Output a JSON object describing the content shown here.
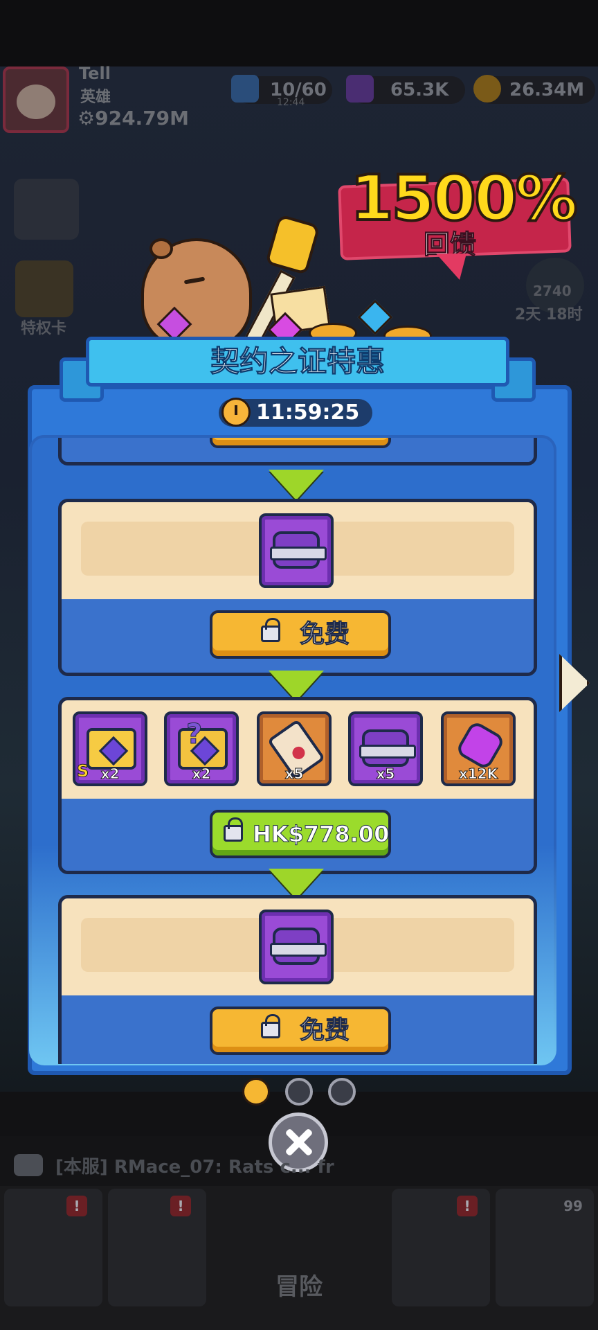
{
  "hud": {
    "player_name": "Tell",
    "player_title": "英雄",
    "power": "924.79M",
    "energy": "10/60",
    "energy_timer": "12:44",
    "gems": "65.3K",
    "gold": "26.34M"
  },
  "side_labels": {
    "privilege_card": "特权卡",
    "event_timer_value": "2740",
    "event_timer_days": "2天 18时"
  },
  "promo": {
    "percent": "1500%",
    "caption": "回馈"
  },
  "panel": {
    "title": "契约之证特惠",
    "countdown": "11:59:25"
  },
  "tiers": [
    {
      "button_label": "免费"
    },
    {
      "button_label": "免费",
      "items": [
        {
          "icon": "purple-chest-icon",
          "qty": ""
        }
      ]
    },
    {
      "button_label": "HK$778.00",
      "items": [
        {
          "icon": "gold-chest-icon",
          "qty": "x2",
          "badge": "S"
        },
        {
          "icon": "mystery-chest-icon",
          "qty": "x2"
        },
        {
          "icon": "scroll-icon",
          "qty": "x5"
        },
        {
          "icon": "purple-chest-icon",
          "qty": "x5"
        },
        {
          "icon": "gem-icon",
          "qty": "x12K"
        }
      ]
    },
    {
      "button_label": "免费",
      "items": [
        {
          "icon": "purple-chest-icon",
          "qty": ""
        }
      ]
    }
  ],
  "pagination": {
    "pages": 3,
    "active_index": 0
  },
  "chat": {
    "message": "[本服] RMace_07: Rats c... fr"
  },
  "nav": {
    "adventure_label": "冒险",
    "badge_count": "99"
  },
  "colors": {
    "panel_blue": "#2f79d9",
    "header_cyan": "#3fc0ee",
    "free_button": "#f6b733",
    "paid_button": "#9bdb2c",
    "promo_red": "#c5254a",
    "promo_yellow": "#ffd91c"
  }
}
